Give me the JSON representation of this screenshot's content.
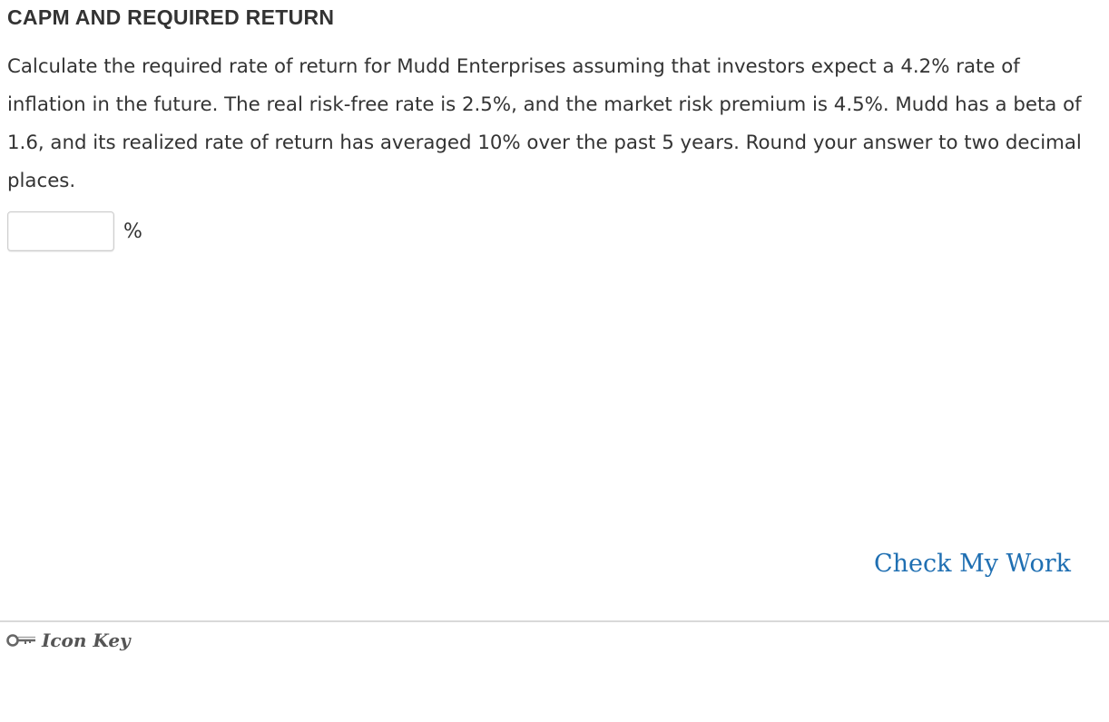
{
  "problem": {
    "title": "CAPM AND REQUIRED RETURN",
    "question_text": "Calculate the required rate of return for Mudd Enterprises assuming that investors expect a 4.2% rate of inflation in the future. The real risk-free rate is 2.5%, and the market risk premium is 4.5%. Mudd has a beta of 1.6, and its realized rate of return has averaged 10% over the past 5 years. Round your answer to two decimal places.",
    "answer": {
      "value": "",
      "unit": "%"
    }
  },
  "actions": {
    "check_my_work_label": "Check My Work"
  },
  "footer": {
    "icon_key_label": "Icon Key",
    "icon": "key-icon",
    "link_color": "#1f6fb2"
  }
}
